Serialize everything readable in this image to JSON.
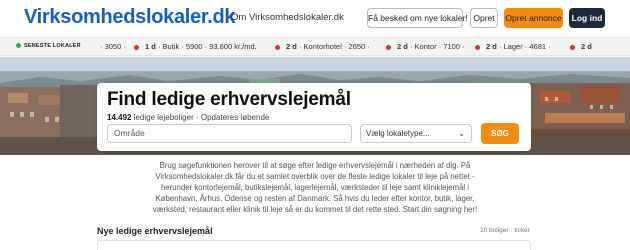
{
  "header": {
    "logo": "Virksomhedslokaler.dk",
    "about_link": "Om Virksomhedslokaler.dk",
    "notify_button": "Få besked om nye lokaler!",
    "create_button": "Opret",
    "advert_button": "Opret annonce",
    "login_button": "Log ind",
    "colors": {
      "brand": "#1a5fb4",
      "accent": "#f28c13",
      "dark": "#1c2b3a"
    }
  },
  "ticker": {
    "label": "SENESTE LOKALER",
    "items": [
      {
        "age": "",
        "text": "· 3050 ·"
      },
      {
        "age": "1 d",
        "text": "· Butik · 5900 · 93.600 kr./md."
      },
      {
        "age": "2 d",
        "text": "· Kontorhotel · 2650 ·"
      },
      {
        "age": "2 d",
        "text": "· Kontor · 7100 ·"
      },
      {
        "age": "2 d",
        "text": "· Lager · 4681 ·"
      },
      {
        "age": "2 d",
        "text": ""
      }
    ]
  },
  "search": {
    "title": "Find ledige erhvervslejemål",
    "count": "14.492",
    "subtitle": "ledige lejeboliger · Opdateres løbende",
    "area_placeholder": "Område",
    "type_placeholder": "Vælg lokaletype...",
    "search_button": "SØG"
  },
  "description": "Brug søgefunktionen herover til at søge efter ledige erhvervslejemål i nærheden af dig. På Virksomhedslokaler.dk får du et samlet overblik over de fleste ledige lokaler til leje på nettet - herunder kontorlejemål, butikslejemål, lagerlejemål, værksteder til leje samt kliniklejemål i København, Århus, Odense og resten af Danmark. Så hvis du leder efter kontor, butik, lager, værksted, restaurant eller klinik til leje så er du kommet til det rette sted. Start din søgning her!",
  "listings": {
    "title": "Nye ledige erhvervslejemål",
    "meta": "10 boliger · ticker"
  }
}
